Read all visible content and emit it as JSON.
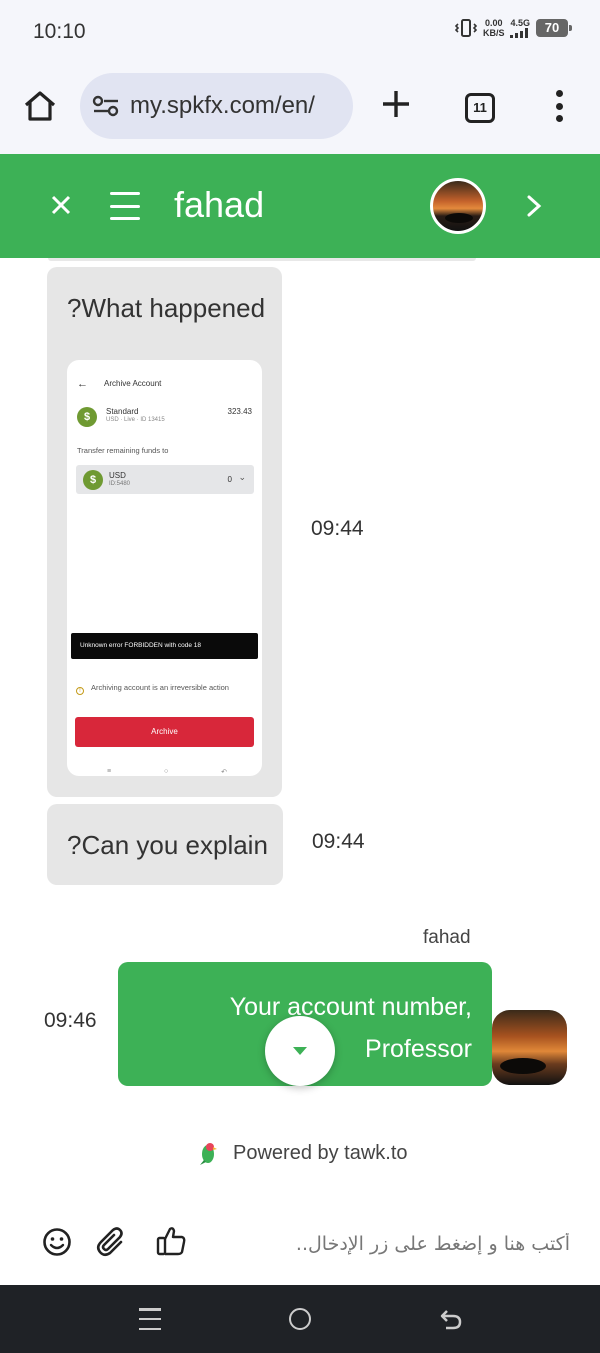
{
  "status_bar": {
    "time": "10:10",
    "net_speed_value": "0.00",
    "net_speed_unit": "KB/S",
    "network_type": "4.5G",
    "battery": "70"
  },
  "browser": {
    "url": "my.spkfx.com/en/",
    "tab_count": "11"
  },
  "chat_header": {
    "agent_name": "fahad"
  },
  "messages": [
    {
      "text": "?What happened",
      "time": "09:44",
      "attachment": {
        "title": "Archive Account",
        "account_type": "Standard",
        "account_meta": "USD · Live · ID 13415",
        "balance": "323.43",
        "transfer_label": "Transfer remaining funds to",
        "target_currency": "USD",
        "target_id": "ID:5480",
        "target_amount": "0",
        "error": "Unknown error FORBIDDEN with code 18",
        "warning": "Archiving account is an irreversible action",
        "archive_button": "Archive"
      }
    },
    {
      "text": "?Can you explain",
      "time": "09:44"
    }
  ],
  "outgoing": {
    "sender": "fahad",
    "line1": "Your account number,",
    "line2": "Professor",
    "time": "09:46"
  },
  "footer": {
    "powered_by": "Powered by tawk.to"
  },
  "composer": {
    "placeholder": "أكتب هنا و إضغط على زر الإدخال.."
  },
  "colors": {
    "brand_green": "#3db156",
    "bubble_gray": "#e6e6e6",
    "archive_red": "#d8273a"
  }
}
